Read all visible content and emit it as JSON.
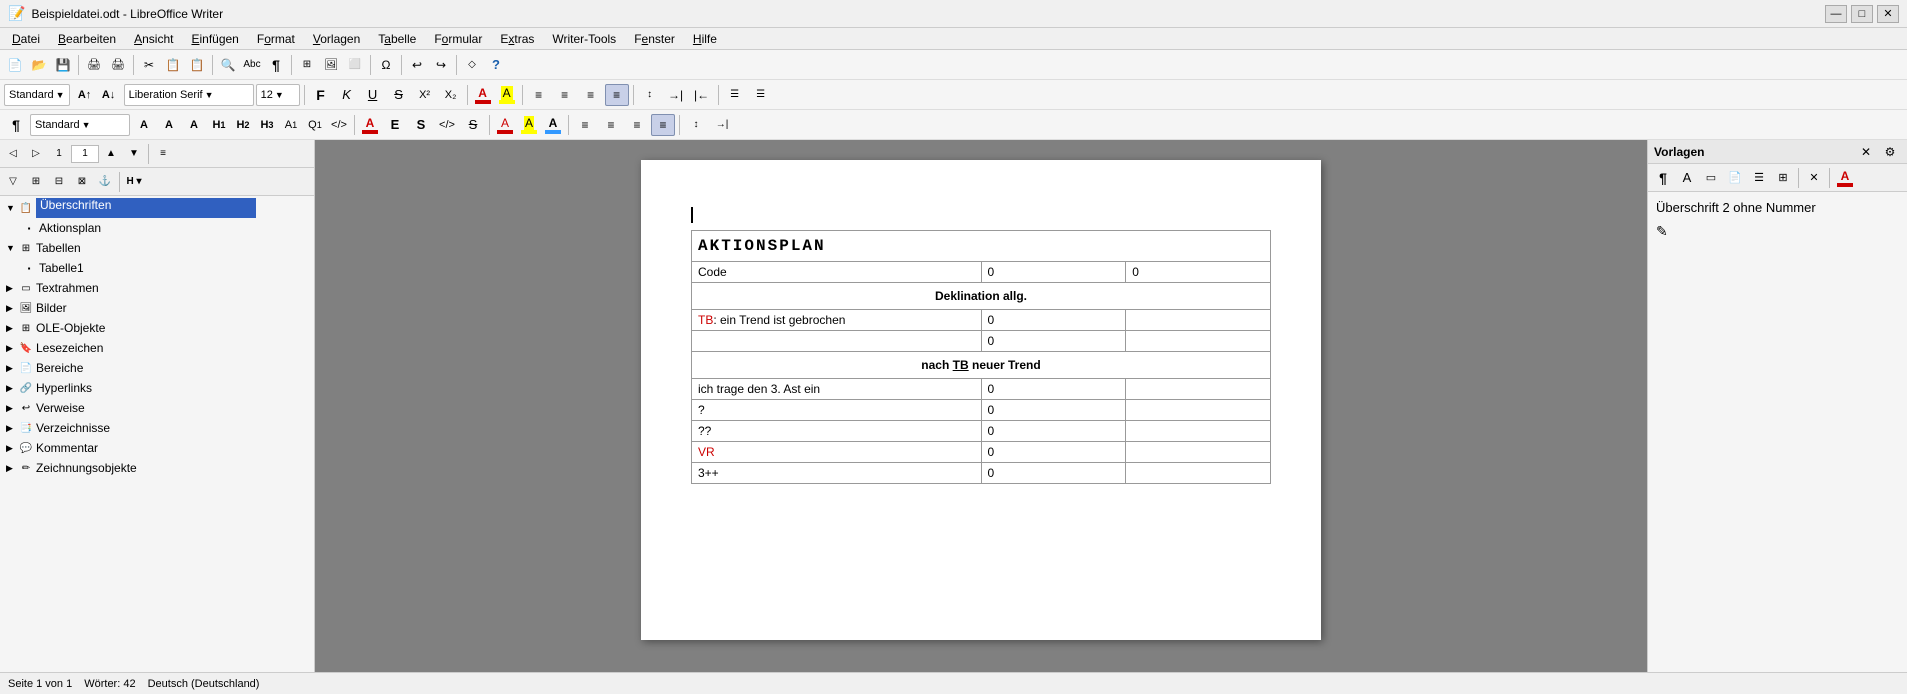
{
  "titlebar": {
    "title": "Beispieldatei.odt - LibreOffice Writer",
    "minimize": "—",
    "maximize": "□",
    "close": "✕"
  },
  "menubar": {
    "items": [
      "Datei",
      "Bearbeiten",
      "Ansicht",
      "Einfügen",
      "Format",
      "Vorlagen",
      "Tabelle",
      "Formular",
      "Extras",
      "Writer-Tools",
      "Fenster",
      "Hilfe"
    ]
  },
  "toolbar": {
    "style_dropdown": "Standard",
    "font_name": "Liberation Serif",
    "font_size": "12",
    "bold": "F",
    "italic": "K",
    "underline": "U",
    "strikethrough": "S",
    "superscript": "X²",
    "subscript": "X₂"
  },
  "navigator": {
    "items": [
      {
        "id": "ueberschriften",
        "label": "Überschriften",
        "level": 0,
        "expanded": true,
        "type": "group"
      },
      {
        "id": "aktionsplan",
        "label": "Aktionsplan",
        "level": 1,
        "type": "item"
      },
      {
        "id": "tabellen",
        "label": "Tabellen",
        "level": 0,
        "expanded": true,
        "type": "group"
      },
      {
        "id": "tabelle1",
        "label": "Tabelle1",
        "level": 1,
        "type": "item"
      },
      {
        "id": "textrahmen",
        "label": "Textrahmen",
        "level": 0,
        "type": "item"
      },
      {
        "id": "bilder",
        "label": "Bilder",
        "level": 0,
        "type": "item"
      },
      {
        "id": "ole-objekte",
        "label": "OLE-Objekte",
        "level": 0,
        "type": "item"
      },
      {
        "id": "lesezeichen",
        "label": "Lesezeichen",
        "level": 0,
        "type": "item"
      },
      {
        "id": "bereiche",
        "label": "Bereiche",
        "level": 0,
        "type": "item"
      },
      {
        "id": "hyperlinks",
        "label": "Hyperlinks",
        "level": 0,
        "type": "item"
      },
      {
        "id": "verweise",
        "label": "Verweise",
        "level": 0,
        "type": "item"
      },
      {
        "id": "verzeichnisse",
        "label": "Verzeichnisse",
        "level": 0,
        "type": "item"
      },
      {
        "id": "kommentar",
        "label": "Kommentar",
        "level": 0,
        "type": "item"
      },
      {
        "id": "zeichnungsobjekte",
        "label": "Zeichnungsobjekte",
        "level": 0,
        "type": "item"
      }
    ]
  },
  "document": {
    "heading": "AKTIONSPLAN",
    "table": {
      "rows": [
        {
          "label": "Code",
          "value1": "0",
          "value2": "0",
          "colspan": true
        },
        {
          "label": "Deklination allg.",
          "section": true
        },
        {
          "label": "TB: ein Trend ist gebrochen",
          "value1": "0"
        },
        {
          "label": "",
          "value1": "0"
        },
        {
          "label": "nach TB neuer Trend",
          "section": true
        },
        {
          "label": "ich trage den 3. Ast ein",
          "value1": "0"
        },
        {
          "label": "?",
          "value1": "0"
        },
        {
          "label": "??",
          "value1": "0"
        },
        {
          "label": "VR",
          "value1": "0"
        },
        {
          "label": "3++",
          "value1": "0"
        }
      ]
    }
  },
  "vorlagen": {
    "title": "Vorlagen",
    "style_name": "Überschrift 2 ohne Nummer"
  },
  "statusbar": {
    "page_info": "Seite 1 von 1",
    "word_count": "Wörter: 42",
    "language": "Deutsch (Deutschland)"
  }
}
